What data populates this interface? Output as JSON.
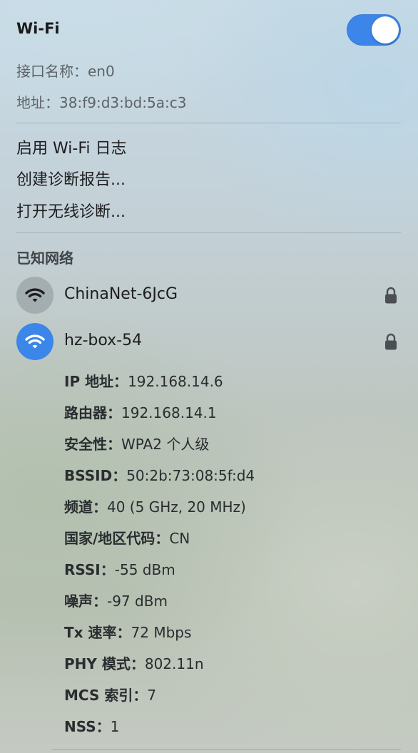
{
  "header": {
    "title": "Wi-Fi",
    "toggle_on": true
  },
  "interface": {
    "name_label": "接口名称：",
    "name_value": "en0",
    "address_label": "地址：",
    "address_value": "38:f9:d3:bd:5a:c3"
  },
  "menu": {
    "items": [
      "启用 Wi-Fi 日志",
      "创建诊断报告...",
      "打开无线诊断..."
    ]
  },
  "known_networks": {
    "title": "已知网络",
    "networks": [
      {
        "name": "ChinaNet-6JcG",
        "secured": true,
        "connected": false,
        "icon": "wifi-icon"
      },
      {
        "name": "hz-box-54",
        "secured": true,
        "connected": true,
        "icon": "wifi-icon"
      }
    ]
  },
  "details": [
    {
      "key": "IP 地址：",
      "value": "192.168.14.6"
    },
    {
      "key": "路由器：",
      "value": "192.168.14.1"
    },
    {
      "key": "安全性：",
      "value": "WPA2 个人级"
    },
    {
      "key": "BSSID：",
      "value": "50:2b:73:08:5f:d4"
    },
    {
      "key": "频道：",
      "value": "40 (5 GHz, 20 MHz)"
    },
    {
      "key": "国家/地区代码：",
      "value": "CN"
    },
    {
      "key": "RSSI：",
      "value": "-55 dBm"
    },
    {
      "key": "噪声：",
      "value": "-97 dBm"
    },
    {
      "key": "Tx 速率：",
      "value": "72 Mbps"
    },
    {
      "key": "PHY 模式：",
      "value": "802.11n"
    },
    {
      "key": "MCS 索引：",
      "value": "7"
    },
    {
      "key": "NSS：",
      "value": "1"
    }
  ],
  "colors": {
    "accent": "#3b86e8",
    "inactive_icon_bg": "#8c9498"
  }
}
